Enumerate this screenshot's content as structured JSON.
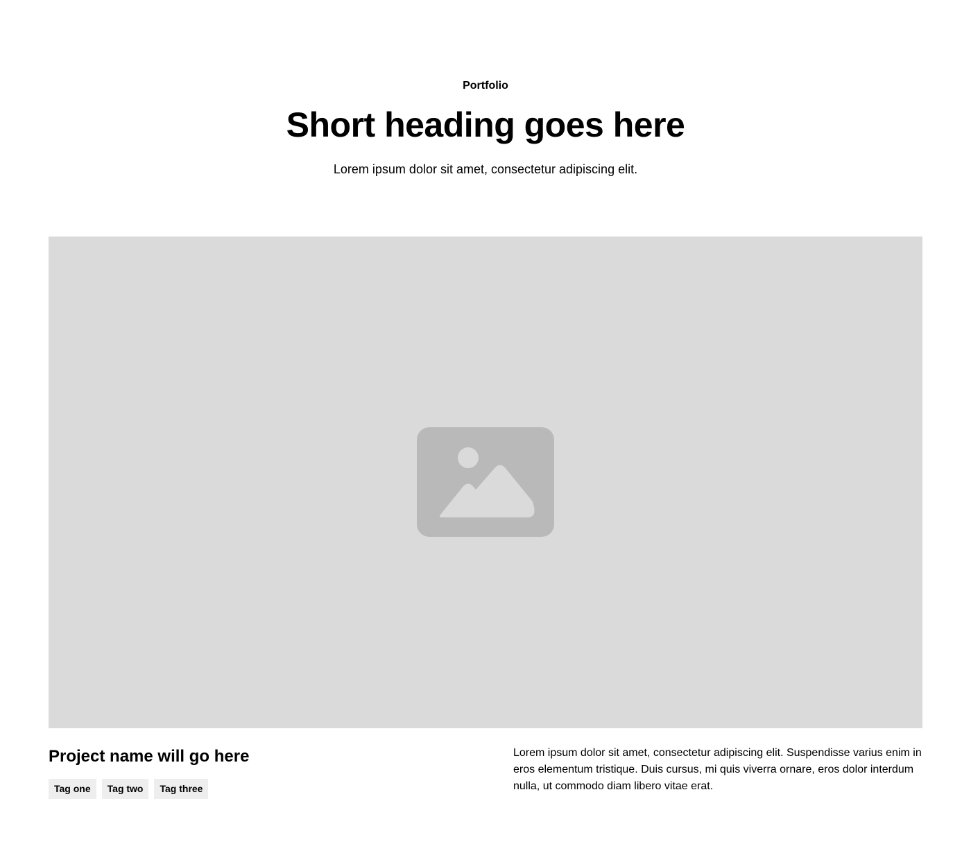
{
  "header": {
    "eyebrow": "Portfolio",
    "title": "Short heading goes here",
    "subtitle": "Lorem ipsum dolor sit amet, consectetur adipiscing elit."
  },
  "hero_image": {
    "icon": "image-placeholder-icon",
    "background_color": "#dadada",
    "icon_color": "#b9b9b9"
  },
  "project": {
    "name": "Project name will go here",
    "tags": [
      "Tag one",
      "Tag two",
      "Tag three"
    ],
    "description": "Lorem ipsum dolor sit amet, consectetur adipiscing elit. Suspendisse varius enim in eros elementum tristique. Duis cursus, mi quis viverra ornare, eros dolor interdum nulla, ut commodo diam libero vitae erat."
  }
}
